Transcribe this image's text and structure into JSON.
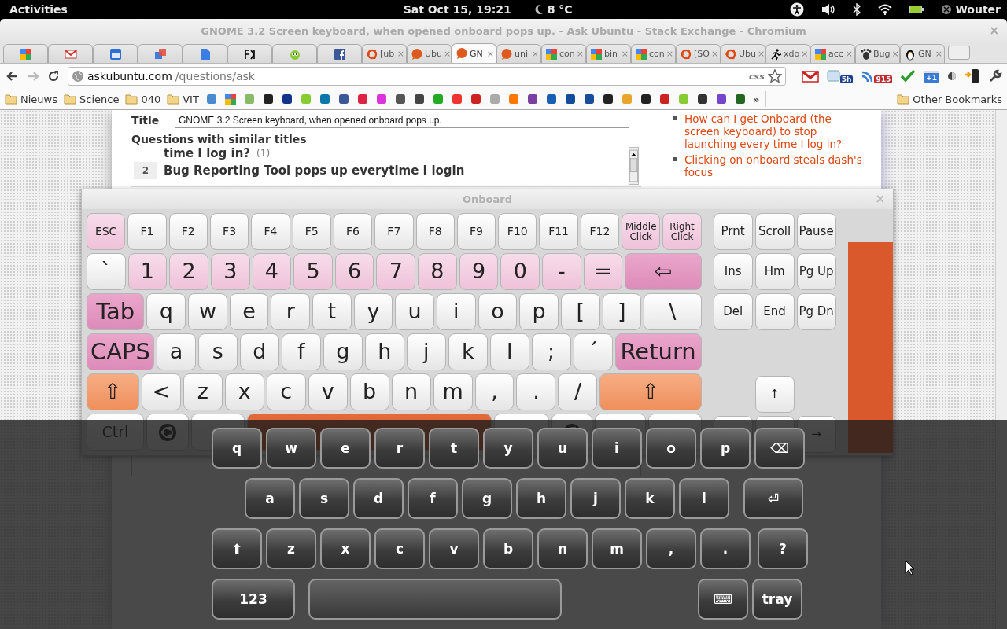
{
  "top_bar": {
    "activities": "Activities",
    "clock": "Sat Oct 15, 19:21",
    "weather": "8 °C",
    "user": "Wouter"
  },
  "browser": {
    "title": "GNOME 3.2 Screen keyboard, when opened onboard pops up. - Ask Ubuntu - Stack Exchange - Chromium",
    "close": "×",
    "tabs": [
      {
        "selected": false
      },
      {
        "selected": false
      },
      {
        "selected": false
      },
      {
        "selected": false
      },
      {
        "selected": false
      },
      {
        "selected": false
      },
      {
        "selected": false
      },
      {
        "selected": false
      },
      {
        "label": "[ub",
        "close": "×",
        "selected": false
      },
      {
        "label": "Ubu",
        "close": "×",
        "selected": false
      },
      {
        "label": "GN",
        "close": "×",
        "selected": true
      },
      {
        "label": "uni",
        "close": "×",
        "selected": false
      },
      {
        "label": "con",
        "close": "×",
        "selected": false
      },
      {
        "label": "bin",
        "close": "×",
        "selected": false
      },
      {
        "label": "con",
        "close": "×",
        "selected": false
      },
      {
        "label": "[SO",
        "close": "×",
        "selected": false
      },
      {
        "label": "Ubu",
        "close": "×",
        "selected": false
      },
      {
        "label": "xdo",
        "close": "×",
        "selected": false
      },
      {
        "label": "acc",
        "close": "×",
        "selected": false
      },
      {
        "label": "Bug",
        "close": "×",
        "selected": false
      },
      {
        "label": "GN",
        "close": "×",
        "selected": false
      }
    ],
    "url": {
      "domain": "askubuntu.com",
      "path": "/questions/ask"
    },
    "url_hint": "css",
    "extension_badges": [
      "5h",
      "915"
    ],
    "plus_one": "+1",
    "bookmark_folders": [
      "Nieuws",
      "Science",
      "040",
      "VIT"
    ],
    "more_bookmarks": "»",
    "other_bookmarks": "Other Bookmarks"
  },
  "page": {
    "title_label": "Title",
    "title_value": "GNOME 3.2 Screen keyboard, when opened onboard pops up.",
    "similar_heading": "Questions with similar titles",
    "similar": [
      {
        "title": "time I log in?",
        "count": "(1)"
      },
      {
        "votes": "2",
        "title": "Bug Reporting Tool pops up everytime I login"
      }
    ],
    "related": [
      "How can I get Onboard (the screen keyboard) to stop launching every time I log in?",
      "Clicking on onboard steals dash's focus"
    ]
  },
  "onboard": {
    "title": "Onboard",
    "close": "×",
    "main_rows": [
      [
        {
          "label": "ESC",
          "kind": "accent"
        },
        {
          "label": "F1",
          "kind": "normal"
        },
        {
          "label": "F2",
          "kind": "normal"
        },
        {
          "label": "F3",
          "kind": "normal"
        },
        {
          "label": "F4",
          "kind": "normal"
        },
        {
          "label": "F5",
          "kind": "normal"
        },
        {
          "label": "F6",
          "kind": "normal"
        },
        {
          "label": "F7",
          "kind": "normal"
        },
        {
          "label": "F8",
          "kind": "normal"
        },
        {
          "label": "F9",
          "kind": "normal"
        },
        {
          "label": "F10",
          "kind": "normal"
        },
        {
          "label": "F11",
          "kind": "normal"
        },
        {
          "label": "F12",
          "kind": "normal"
        },
        {
          "label": "Middle Click",
          "kind": "accent"
        },
        {
          "label": "Right Click",
          "kind": "accent"
        }
      ],
      [
        {
          "label": "`",
          "kind": "normal"
        },
        {
          "label": "1",
          "kind": "accent"
        },
        {
          "label": "2",
          "kind": "accent"
        },
        {
          "label": "3",
          "kind": "accent"
        },
        {
          "label": "4",
          "kind": "accent"
        },
        {
          "label": "5",
          "kind": "accent"
        },
        {
          "label": "6",
          "kind": "accent"
        },
        {
          "label": "7",
          "kind": "accent"
        },
        {
          "label": "8",
          "kind": "accent"
        },
        {
          "label": "9",
          "kind": "accent"
        },
        {
          "label": "0",
          "kind": "accent"
        },
        {
          "label": "-",
          "kind": "accent"
        },
        {
          "label": "=",
          "kind": "accent"
        },
        {
          "label": "⇦",
          "kind": "strong"
        }
      ],
      [
        {
          "label": "Tab",
          "kind": "strong"
        },
        {
          "label": "q",
          "kind": "normal"
        },
        {
          "label": "w",
          "kind": "normal"
        },
        {
          "label": "e",
          "kind": "normal"
        },
        {
          "label": "r",
          "kind": "normal"
        },
        {
          "label": "t",
          "kind": "normal"
        },
        {
          "label": "y",
          "kind": "normal"
        },
        {
          "label": "u",
          "kind": "normal"
        },
        {
          "label": "i",
          "kind": "normal"
        },
        {
          "label": "o",
          "kind": "normal"
        },
        {
          "label": "p",
          "kind": "normal"
        },
        {
          "label": "[",
          "kind": "normal"
        },
        {
          "label": "]",
          "kind": "normal"
        },
        {
          "label": "\\",
          "kind": "normal"
        }
      ],
      [
        {
          "label": "CAPS",
          "kind": "strong"
        },
        {
          "label": "a",
          "kind": "normal"
        },
        {
          "label": "s",
          "kind": "normal"
        },
        {
          "label": "d",
          "kind": "normal"
        },
        {
          "label": "f",
          "kind": "normal"
        },
        {
          "label": "g",
          "kind": "normal"
        },
        {
          "label": "h",
          "kind": "normal"
        },
        {
          "label": "j",
          "kind": "normal"
        },
        {
          "label": "k",
          "kind": "normal"
        },
        {
          "label": "l",
          "kind": "normal"
        },
        {
          "label": ";",
          "kind": "normal"
        },
        {
          "label": "´",
          "kind": "normal"
        },
        {
          "label": "Return",
          "kind": "strong"
        }
      ],
      [
        {
          "label": "⇧",
          "kind": "shift"
        },
        {
          "label": "<",
          "kind": "normal"
        },
        {
          "label": "z",
          "kind": "normal"
        },
        {
          "label": "x",
          "kind": "normal"
        },
        {
          "label": "c",
          "kind": "normal"
        },
        {
          "label": "v",
          "kind": "normal"
        },
        {
          "label": "b",
          "kind": "normal"
        },
        {
          "label": "n",
          "kind": "normal"
        },
        {
          "label": "m",
          "kind": "normal"
        },
        {
          "label": ",",
          "kind": "normal"
        },
        {
          "label": ".",
          "kind": "normal"
        },
        {
          "label": "/",
          "kind": "normal"
        },
        {
          "label": "⇧",
          "kind": "shift"
        }
      ],
      [
        {
          "label": "Ctrl",
          "kind": "normal"
        },
        {
          "kind": "logo"
        },
        {
          "kind": "normal"
        },
        {
          "kind": "space"
        },
        {
          "kind": "normal"
        },
        {
          "kind": "logo"
        },
        {
          "kind": "normal"
        },
        {
          "kind": "normal"
        }
      ]
    ],
    "side_rows": [
      [
        {
          "label": "Prnt",
          "kind": "normal"
        },
        {
          "label": "Scroll",
          "kind": "normal"
        },
        {
          "label": "Pause",
          "kind": "normal"
        }
      ],
      [
        {
          "label": "Ins",
          "kind": "normal"
        },
        {
          "label": "Hm",
          "kind": "normal"
        },
        {
          "label": "Pg Up",
          "kind": "normal"
        }
      ],
      [
        {
          "label": "Del",
          "kind": "normal"
        },
        {
          "label": "End",
          "kind": "normal"
        },
        {
          "label": "Pg Dn",
          "kind": "normal"
        }
      ],
      [
        {
          "label": "↑",
          "kind": "normal"
        }
      ],
      [
        {
          "kind": "normal"
        },
        {
          "kind": "normal"
        },
        {
          "label": "→",
          "kind": "normal"
        }
      ]
    ]
  },
  "screen_keyboard": {
    "rows": [
      [
        {
          "label": "q",
          "kind": "key"
        },
        {
          "label": "w",
          "kind": "key"
        },
        {
          "label": "e",
          "kind": "key"
        },
        {
          "label": "r",
          "kind": "key"
        },
        {
          "label": "t",
          "kind": "key"
        },
        {
          "label": "y",
          "kind": "key"
        },
        {
          "label": "u",
          "kind": "key"
        },
        {
          "label": "i",
          "kind": "key"
        },
        {
          "label": "o",
          "kind": "key"
        },
        {
          "label": "p",
          "kind": "key"
        },
        {
          "label": "⌫",
          "kind": "key"
        }
      ],
      [
        {
          "label": "a",
          "kind": "key"
        },
        {
          "label": "s",
          "kind": "key"
        },
        {
          "label": "d",
          "kind": "key"
        },
        {
          "label": "f",
          "kind": "key"
        },
        {
          "label": "g",
          "kind": "key"
        },
        {
          "label": "h",
          "kind": "key"
        },
        {
          "label": "j",
          "kind": "key"
        },
        {
          "label": "k",
          "kind": "key"
        },
        {
          "label": "l",
          "kind": "key"
        },
        {
          "kind": "gap"
        },
        {
          "label": "⏎",
          "kind": "wide"
        }
      ],
      [
        {
          "label": "⬆",
          "kind": "key"
        },
        {
          "label": "z",
          "kind": "key"
        },
        {
          "label": "x",
          "kind": "key"
        },
        {
          "label": "c",
          "kind": "key"
        },
        {
          "label": "v",
          "kind": "key"
        },
        {
          "label": "b",
          "kind": "key"
        },
        {
          "label": "n",
          "kind": "key"
        },
        {
          "label": "m",
          "kind": "key"
        },
        {
          "label": ",",
          "kind": "key"
        },
        {
          "label": ".",
          "kind": "key"
        },
        {
          "label": "?",
          "kind": "key"
        }
      ],
      [
        {
          "label": "123",
          "kind": "wide"
        },
        {
          "kind": "space"
        },
        {
          "kind": "gap"
        },
        {
          "kind": "gap"
        },
        {
          "kind": "gap"
        },
        {
          "kind": "gap"
        },
        {
          "kind": "gap"
        },
        {
          "kind": "gap"
        },
        {
          "kind": "gap"
        },
        {
          "label": "⌨",
          "kind": "key"
        },
        {
          "label": "tray",
          "kind": "key"
        }
      ]
    ]
  }
}
